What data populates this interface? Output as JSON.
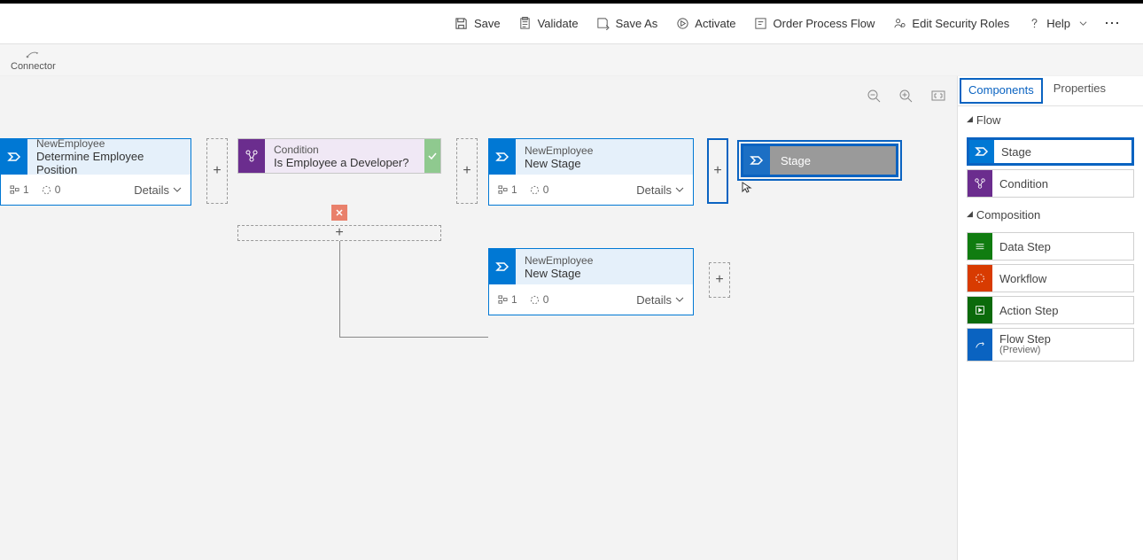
{
  "toolbar": {
    "save": "Save",
    "validate": "Validate",
    "save_as": "Save As",
    "activate": "Activate",
    "order": "Order Process Flow",
    "security": "Edit Security Roles",
    "help": "Help"
  },
  "connector_tab": "Connector",
  "stages": {
    "s1": {
      "entity": "NewEmployee",
      "name": "Determine Employee Position",
      "steps": "1",
      "count": "0",
      "details": "Details"
    },
    "s2": {
      "entity": "NewEmployee",
      "name": "New Stage",
      "steps": "1",
      "count": "0",
      "details": "Details"
    },
    "s3": {
      "entity": "NewEmployee",
      "name": "New Stage",
      "steps": "1",
      "count": "0",
      "details": "Details"
    }
  },
  "condition": {
    "title": "Condition",
    "name": "Is Employee a Developer?"
  },
  "drag": {
    "label": "Stage"
  },
  "side": {
    "tab_components": "Components",
    "tab_properties": "Properties",
    "sect_flow": "Flow",
    "sect_composition": "Composition",
    "items": {
      "stage": "Stage",
      "condition": "Condition",
      "data_step": "Data Step",
      "workflow": "Workflow",
      "action_step": "Action Step",
      "flow_step": "Flow Step",
      "flow_step_sub": "(Preview)"
    }
  }
}
